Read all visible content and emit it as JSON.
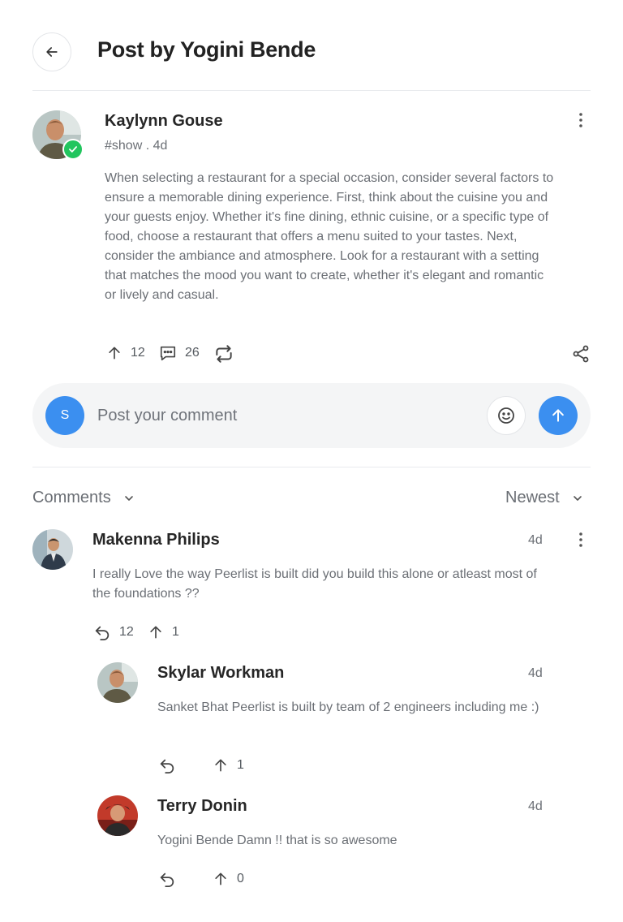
{
  "header": {
    "title": "Post by Yogini Bende"
  },
  "post": {
    "author": "Kaylynn Gouse",
    "meta": "#show . 4d",
    "body": "When selecting a restaurant for a special occasion, consider several factors to ensure a memorable dining experience. First, think about the cuisine you and your guests enjoy. Whether it's fine dining, ethnic cuisine, or a specific type of food, choose a restaurant that offers a menu suited to your tastes. Next, consider the ambiance and atmosphere. Look for a restaurant with a setting that matches the mood you want to create, whether it's elegant and romantic or lively and casual.",
    "upvotes": "12",
    "comments": "26"
  },
  "composer": {
    "avatar_initial": "S",
    "placeholder": "Post your comment"
  },
  "comments_section": {
    "label": "Comments",
    "sort": "Newest"
  },
  "comments": [
    {
      "name": "Makenna Philips",
      "time": "4d",
      "text": "I really Love the way Peerlist is built did you build this alone or atleast most of the foundations ??",
      "replies": "12",
      "upvotes": "1"
    },
    {
      "name": "Skylar Workman",
      "time": "4d",
      "text": "Sanket Bhat Peerlist is built by team of 2 engineers including me :)",
      "upvotes": "1"
    },
    {
      "name": "Terry Donin",
      "time": "4d",
      "text": "Yogini Bende Damn !! that is so awesome",
      "upvotes": "0"
    }
  ],
  "colors": {
    "accent": "#3b8ff0",
    "verified": "#22c55e",
    "muted_text": "#6b6f75"
  }
}
